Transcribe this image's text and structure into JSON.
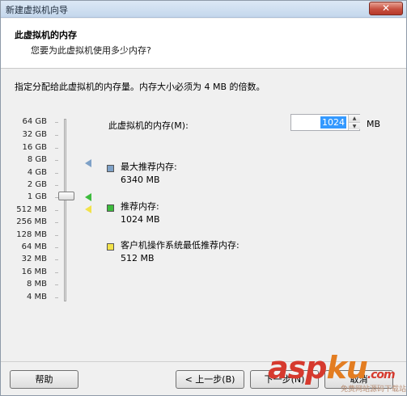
{
  "window": {
    "title": "新建虚拟机向导",
    "close_label": "✕"
  },
  "header": {
    "title": "此虚拟机的内存",
    "subtitle": "您要为此虚拟机使用多少内存?"
  },
  "intro_text": "指定分配给此虚拟机的内存量。内存大小必须为 4 MB 的倍数。",
  "scale": {
    "labels": [
      "64 GB",
      "32 GB",
      "16 GB",
      "8 GB",
      "4 GB",
      "2 GB",
      "1 GB",
      "512 MB",
      "256 MB",
      "128 MB",
      "64 MB",
      "32 MB",
      "16 MB",
      "8 MB",
      "4 MB"
    ],
    "current_value_label": "1 GB"
  },
  "memory": {
    "label": "此虚拟机的内存(M):",
    "value": "1024",
    "unit": "MB"
  },
  "legend": {
    "max": {
      "title": "最大推荐内存:",
      "value": "6340 MB",
      "color": "#7ea1c7"
    },
    "recommended": {
      "title": "推荐内存:",
      "value": "1024 MB",
      "color": "#3dbb3d"
    },
    "min": {
      "title": "客户机操作系统最低推荐内存:",
      "value": "512 MB",
      "color": "#f2e24a"
    }
  },
  "buttons": {
    "help": "帮助",
    "back": "< 上一步(B)",
    "next": "下一步(N)",
    "cancel": "取消"
  },
  "watermark": {
    "main_a": "asp",
    "main_b": "ku",
    "suffix": ".com",
    "sub": "免费网站源码下载站"
  }
}
